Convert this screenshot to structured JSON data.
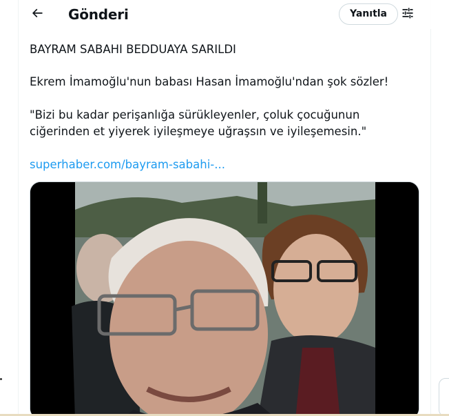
{
  "header": {
    "title": "Gönderi",
    "reply_label": "Yanıtla",
    "back_icon": "arrow-left-icon",
    "settings_icon": "sliders-icon"
  },
  "tweet": {
    "line1": "BAYRAM SABAHI BEDDUAYA SARILDI",
    "line2": "Ekrem İmamoğlu'nun babası Hasan İmamoğlu'ndan şok sözler!",
    "line3": "\"Bizi bu kadar perişanlığa sürükleyenler, çoluk çocuğunun ciğerinden et yiyerek iyileşmeye uğraşsın ve iyileşemesin.\"",
    "link": "superhaber.com/bayram-sabahi-..."
  },
  "colors": {
    "link": "#1d9bf0",
    "text": "#0f1419",
    "border": "#cfd9de"
  }
}
